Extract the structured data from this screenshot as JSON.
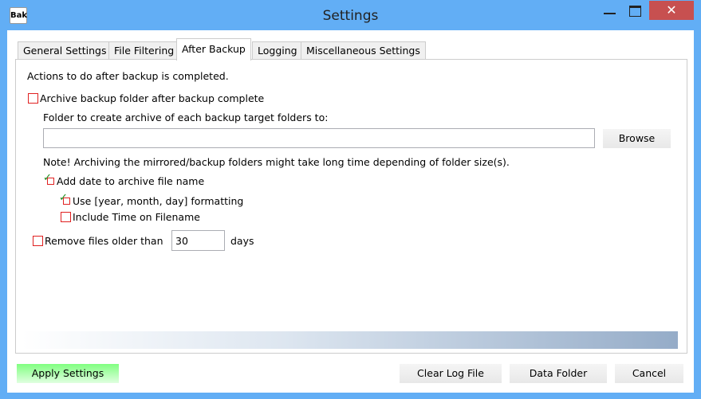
{
  "window": {
    "title": "Settings",
    "icon_text": "Bak",
    "close": "✕"
  },
  "tabs": [
    {
      "label": "General Settings"
    },
    {
      "label": "File Filtering"
    },
    {
      "label": "After Backup"
    },
    {
      "label": "Logging"
    },
    {
      "label": "Miscellaneous Settings"
    }
  ],
  "active_tab": "After Backup",
  "panel": {
    "heading": "Actions to do after backup is completed.",
    "archive_label": "Archive backup folder after backup complete",
    "archive_checked": false,
    "folder_label": "Folder to create archive of each backup target folders to:",
    "folder_value": "",
    "browse": "Browse",
    "note": "Note! Archiving the mirrored/backup folders might take long time depending of folder size(s).",
    "add_date_label": "Add date to archive file name",
    "add_date_checked": true,
    "ymd_label": "Use [year, month, day] formatting",
    "ymd_checked": true,
    "time_label": "Include Time on Filename",
    "time_checked": false,
    "remove_label": "Remove files older than",
    "remove_checked": false,
    "days_value": "30",
    "days_label": "days"
  },
  "buttons": {
    "apply": "Apply Settings",
    "clear_log": "Clear Log File",
    "data_folder": "Data Folder",
    "cancel": "Cancel"
  },
  "colors": {
    "frame": "#62aef5",
    "close": "#c75050",
    "apply": "#80ff80",
    "checkbox": "#e02020",
    "check": "#1a8a1a"
  }
}
